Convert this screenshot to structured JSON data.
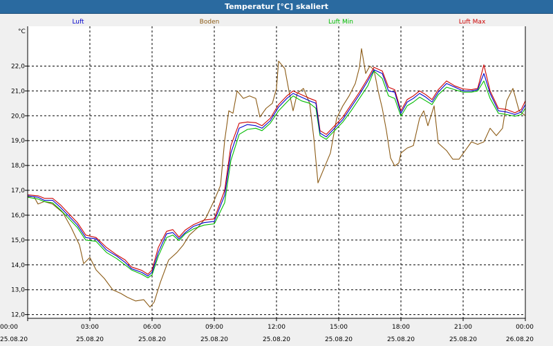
{
  "window": {
    "title": "Temperatur [°C] skaliert"
  },
  "chart_data": {
    "type": "line",
    "title": "Temperatur [°C] skaliert",
    "ylabel": "°C",
    "ylim": [
      11.85,
      23.6
    ],
    "xlim": [
      0,
      24
    ],
    "grid": true,
    "legend_placement": "top",
    "y_ticks": [
      "12,0",
      "13,0",
      "14,0",
      "15,0",
      "16,0",
      "17,0",
      "18,0",
      "19,0",
      "20,0",
      "21,0",
      "22,0"
    ],
    "y_tick_values": [
      12,
      13,
      14,
      15,
      16,
      17,
      18,
      19,
      20,
      21,
      22
    ],
    "x_ticks": [
      {
        "time": "00:00",
        "date": "25.08.20"
      },
      {
        "time": "03:00",
        "date": "25.08.20"
      },
      {
        "time": "06:00",
        "date": "25.08.20"
      },
      {
        "time": "09:00",
        "date": "25.08.20"
      },
      {
        "time": "12:00",
        "date": "25.08.20"
      },
      {
        "time": "15:00",
        "date": "25.08.20"
      },
      {
        "time": "18:00",
        "date": "25.08.20"
      },
      {
        "time": "21:00",
        "date": "25.08.20"
      },
      {
        "time": "00:00",
        "date": "26.08.20"
      }
    ],
    "x_tick_hours": [
      0,
      3,
      6,
      9,
      12,
      15,
      18,
      21,
      24
    ],
    "series": [
      {
        "name": "Luft",
        "color": "#0000cc",
        "points": [
          [
            0,
            16.78
          ],
          [
            0.5,
            16.72
          ],
          [
            0.8,
            16.6
          ],
          [
            1.2,
            16.6
          ],
          [
            1.6,
            16.3
          ],
          [
            2.0,
            15.95
          ],
          [
            2.4,
            15.6
          ],
          [
            2.8,
            15.1
          ],
          [
            3.3,
            15.05
          ],
          [
            3.8,
            14.6
          ],
          [
            4.3,
            14.35
          ],
          [
            4.7,
            14.1
          ],
          [
            5.0,
            13.85
          ],
          [
            5.5,
            13.7
          ],
          [
            5.8,
            13.55
          ],
          [
            6.0,
            13.7
          ],
          [
            6.3,
            14.5
          ],
          [
            6.7,
            15.25
          ],
          [
            7.0,
            15.3
          ],
          [
            7.3,
            15.05
          ],
          [
            7.6,
            15.3
          ],
          [
            8.0,
            15.55
          ],
          [
            8.5,
            15.7
          ],
          [
            9.0,
            15.75
          ],
          [
            9.5,
            16.8
          ],
          [
            9.8,
            18.5
          ],
          [
            10.2,
            19.5
          ],
          [
            10.6,
            19.65
          ],
          [
            11.0,
            19.6
          ],
          [
            11.3,
            19.5
          ],
          [
            11.7,
            19.8
          ],
          [
            12.1,
            20.35
          ],
          [
            12.5,
            20.7
          ],
          [
            12.8,
            20.9
          ],
          [
            13.2,
            20.75
          ],
          [
            13.6,
            20.6
          ],
          [
            13.9,
            20.5
          ],
          [
            14.1,
            19.3
          ],
          [
            14.4,
            19.15
          ],
          [
            14.8,
            19.5
          ],
          [
            15.2,
            19.85
          ],
          [
            15.6,
            20.35
          ],
          [
            16.0,
            20.85
          ],
          [
            16.4,
            21.4
          ],
          [
            16.7,
            21.85
          ],
          [
            17.1,
            21.7
          ],
          [
            17.4,
            21.0
          ],
          [
            17.7,
            20.95
          ],
          [
            18.0,
            20.1
          ],
          [
            18.3,
            20.55
          ],
          [
            18.6,
            20.7
          ],
          [
            18.9,
            20.9
          ],
          [
            19.2,
            20.75
          ],
          [
            19.5,
            20.55
          ],
          [
            19.8,
            20.95
          ],
          [
            20.2,
            21.3
          ],
          [
            20.6,
            21.15
          ],
          [
            21.0,
            21.0
          ],
          [
            21.4,
            21.0
          ],
          [
            21.7,
            21.05
          ],
          [
            22.0,
            21.7
          ],
          [
            22.3,
            20.9
          ],
          [
            22.7,
            20.2
          ],
          [
            23.1,
            20.15
          ],
          [
            23.5,
            20.05
          ],
          [
            23.8,
            20.15
          ],
          [
            24.0,
            20.45
          ]
        ]
      },
      {
        "name": "Boden",
        "color": "#8b5a14",
        "points": [
          [
            0,
            16.75
          ],
          [
            0.3,
            16.75
          ],
          [
            0.5,
            16.45
          ],
          [
            0.8,
            16.55
          ],
          [
            1.2,
            16.45
          ],
          [
            1.7,
            16.1
          ],
          [
            2.1,
            15.5
          ],
          [
            2.5,
            14.8
          ],
          [
            2.7,
            14.05
          ],
          [
            3.0,
            14.3
          ],
          [
            3.3,
            13.8
          ],
          [
            3.7,
            13.45
          ],
          [
            4.1,
            13.0
          ],
          [
            4.5,
            12.85
          ],
          [
            4.8,
            12.7
          ],
          [
            5.2,
            12.55
          ],
          [
            5.6,
            12.6
          ],
          [
            5.9,
            12.3
          ],
          [
            6.1,
            12.5
          ],
          [
            6.4,
            13.3
          ],
          [
            6.8,
            14.2
          ],
          [
            7.2,
            14.5
          ],
          [
            7.5,
            14.8
          ],
          [
            7.8,
            15.2
          ],
          [
            8.2,
            15.5
          ],
          [
            8.6,
            15.9
          ],
          [
            9.0,
            16.6
          ],
          [
            9.3,
            17.2
          ],
          [
            9.5,
            19.0
          ],
          [
            9.7,
            20.2
          ],
          [
            9.9,
            20.1
          ],
          [
            10.1,
            21.0
          ],
          [
            10.4,
            20.7
          ],
          [
            10.7,
            20.8
          ],
          [
            11.0,
            20.7
          ],
          [
            11.2,
            19.95
          ],
          [
            11.5,
            20.3
          ],
          [
            11.8,
            20.5
          ],
          [
            12.0,
            21.1
          ],
          [
            12.1,
            22.2
          ],
          [
            12.4,
            21.9
          ],
          [
            12.6,
            21.0
          ],
          [
            12.8,
            20.2
          ],
          [
            13.0,
            20.9
          ],
          [
            13.3,
            21.1
          ],
          [
            13.6,
            20.5
          ],
          [
            13.8,
            19.1
          ],
          [
            14.0,
            17.3
          ],
          [
            14.3,
            17.9
          ],
          [
            14.6,
            18.5
          ],
          [
            14.9,
            19.9
          ],
          [
            15.2,
            20.4
          ],
          [
            15.5,
            20.8
          ],
          [
            15.8,
            21.3
          ],
          [
            16.0,
            21.95
          ],
          [
            16.1,
            22.7
          ],
          [
            16.3,
            21.7
          ],
          [
            16.5,
            22.0
          ],
          [
            16.7,
            21.85
          ],
          [
            16.9,
            21.0
          ],
          [
            17.1,
            20.3
          ],
          [
            17.3,
            19.4
          ],
          [
            17.5,
            18.3
          ],
          [
            17.7,
            17.98
          ],
          [
            17.9,
            18.1
          ],
          [
            18.0,
            18.5
          ],
          [
            18.3,
            18.7
          ],
          [
            18.6,
            18.8
          ],
          [
            18.9,
            19.9
          ],
          [
            19.1,
            20.2
          ],
          [
            19.3,
            19.6
          ],
          [
            19.6,
            20.4
          ],
          [
            19.8,
            18.9
          ],
          [
            20.2,
            18.6
          ],
          [
            20.5,
            18.25
          ],
          [
            20.8,
            18.25
          ],
          [
            21.1,
            18.6
          ],
          [
            21.4,
            18.95
          ],
          [
            21.7,
            18.85
          ],
          [
            22.0,
            18.95
          ],
          [
            22.3,
            19.5
          ],
          [
            22.6,
            19.2
          ],
          [
            22.9,
            19.5
          ],
          [
            23.1,
            20.6
          ],
          [
            23.4,
            21.1
          ],
          [
            23.7,
            20.2
          ],
          [
            24.0,
            20.0
          ]
        ]
      },
      {
        "name": "Luft Min",
        "color": "#00bb00",
        "points": [
          [
            0,
            16.72
          ],
          [
            0.5,
            16.65
          ],
          [
            0.8,
            16.55
          ],
          [
            1.2,
            16.5
          ],
          [
            1.6,
            16.2
          ],
          [
            2.0,
            15.85
          ],
          [
            2.4,
            15.5
          ],
          [
            2.8,
            15.0
          ],
          [
            3.3,
            14.95
          ],
          [
            3.8,
            14.5
          ],
          [
            4.3,
            14.25
          ],
          [
            4.7,
            14.0
          ],
          [
            5.0,
            13.8
          ],
          [
            5.5,
            13.62
          ],
          [
            5.8,
            13.48
          ],
          [
            6.0,
            13.6
          ],
          [
            6.3,
            14.35
          ],
          [
            6.7,
            15.1
          ],
          [
            7.0,
            15.2
          ],
          [
            7.3,
            14.98
          ],
          [
            7.6,
            15.25
          ],
          [
            8.0,
            15.45
          ],
          [
            8.5,
            15.6
          ],
          [
            9.0,
            15.65
          ],
          [
            9.5,
            16.5
          ],
          [
            9.8,
            18.2
          ],
          [
            10.2,
            19.25
          ],
          [
            10.6,
            19.45
          ],
          [
            11.0,
            19.5
          ],
          [
            11.3,
            19.4
          ],
          [
            11.7,
            19.7
          ],
          [
            12.1,
            20.2
          ],
          [
            12.5,
            20.55
          ],
          [
            12.8,
            20.8
          ],
          [
            13.2,
            20.6
          ],
          [
            13.6,
            20.5
          ],
          [
            13.9,
            20.3
          ],
          [
            14.1,
            19.2
          ],
          [
            14.4,
            19.05
          ],
          [
            14.8,
            19.4
          ],
          [
            15.2,
            19.75
          ],
          [
            15.6,
            20.2
          ],
          [
            16.0,
            20.7
          ],
          [
            16.4,
            21.2
          ],
          [
            16.7,
            21.8
          ],
          [
            17.1,
            21.5
          ],
          [
            17.4,
            20.8
          ],
          [
            17.7,
            20.7
          ],
          [
            18.0,
            19.98
          ],
          [
            18.3,
            20.4
          ],
          [
            18.6,
            20.55
          ],
          [
            18.9,
            20.75
          ],
          [
            19.2,
            20.6
          ],
          [
            19.5,
            20.45
          ],
          [
            19.8,
            20.85
          ],
          [
            20.2,
            21.15
          ],
          [
            20.6,
            21.05
          ],
          [
            21.0,
            20.95
          ],
          [
            21.4,
            20.95
          ],
          [
            21.7,
            21.0
          ],
          [
            22.0,
            21.4
          ],
          [
            22.3,
            20.7
          ],
          [
            22.7,
            20.1
          ],
          [
            23.1,
            20.05
          ],
          [
            23.5,
            19.98
          ],
          [
            23.8,
            20.05
          ],
          [
            24.0,
            20.3
          ]
        ]
      },
      {
        "name": "Luft Max",
        "color": "#cc0000",
        "points": [
          [
            0,
            16.82
          ],
          [
            0.5,
            16.78
          ],
          [
            0.8,
            16.68
          ],
          [
            1.2,
            16.68
          ],
          [
            1.6,
            16.4
          ],
          [
            2.0,
            16.05
          ],
          [
            2.4,
            15.7
          ],
          [
            2.8,
            15.2
          ],
          [
            3.3,
            15.1
          ],
          [
            3.8,
            14.7
          ],
          [
            4.3,
            14.4
          ],
          [
            4.7,
            14.2
          ],
          [
            5.0,
            13.92
          ],
          [
            5.5,
            13.78
          ],
          [
            5.8,
            13.62
          ],
          [
            6.0,
            13.8
          ],
          [
            6.3,
            14.7
          ],
          [
            6.7,
            15.35
          ],
          [
            7.0,
            15.42
          ],
          [
            7.3,
            15.12
          ],
          [
            7.6,
            15.4
          ],
          [
            8.0,
            15.62
          ],
          [
            8.5,
            15.8
          ],
          [
            9.0,
            15.85
          ],
          [
            9.5,
            17.0
          ],
          [
            9.8,
            18.8
          ],
          [
            10.2,
            19.7
          ],
          [
            10.6,
            19.75
          ],
          [
            11.0,
            19.72
          ],
          [
            11.3,
            19.6
          ],
          [
            11.7,
            19.9
          ],
          [
            12.1,
            20.45
          ],
          [
            12.5,
            20.8
          ],
          [
            12.8,
            21.0
          ],
          [
            13.2,
            20.85
          ],
          [
            13.6,
            20.7
          ],
          [
            13.9,
            20.6
          ],
          [
            14.1,
            19.4
          ],
          [
            14.4,
            19.25
          ],
          [
            14.8,
            19.6
          ],
          [
            15.2,
            19.95
          ],
          [
            15.6,
            20.45
          ],
          [
            16.0,
            20.95
          ],
          [
            16.4,
            21.5
          ],
          [
            16.7,
            21.95
          ],
          [
            17.1,
            21.8
          ],
          [
            17.4,
            21.15
          ],
          [
            17.7,
            21.05
          ],
          [
            18.0,
            20.2
          ],
          [
            18.3,
            20.65
          ],
          [
            18.6,
            20.8
          ],
          [
            18.9,
            21.0
          ],
          [
            19.2,
            20.85
          ],
          [
            19.5,
            20.65
          ],
          [
            19.8,
            21.05
          ],
          [
            20.2,
            21.4
          ],
          [
            20.6,
            21.2
          ],
          [
            21.0,
            21.08
          ],
          [
            21.4,
            21.05
          ],
          [
            21.7,
            21.1
          ],
          [
            22.0,
            22.05
          ],
          [
            22.3,
            21.0
          ],
          [
            22.7,
            20.3
          ],
          [
            23.1,
            20.25
          ],
          [
            23.5,
            20.12
          ],
          [
            23.8,
            20.25
          ],
          [
            24.0,
            20.6
          ]
        ]
      }
    ]
  }
}
